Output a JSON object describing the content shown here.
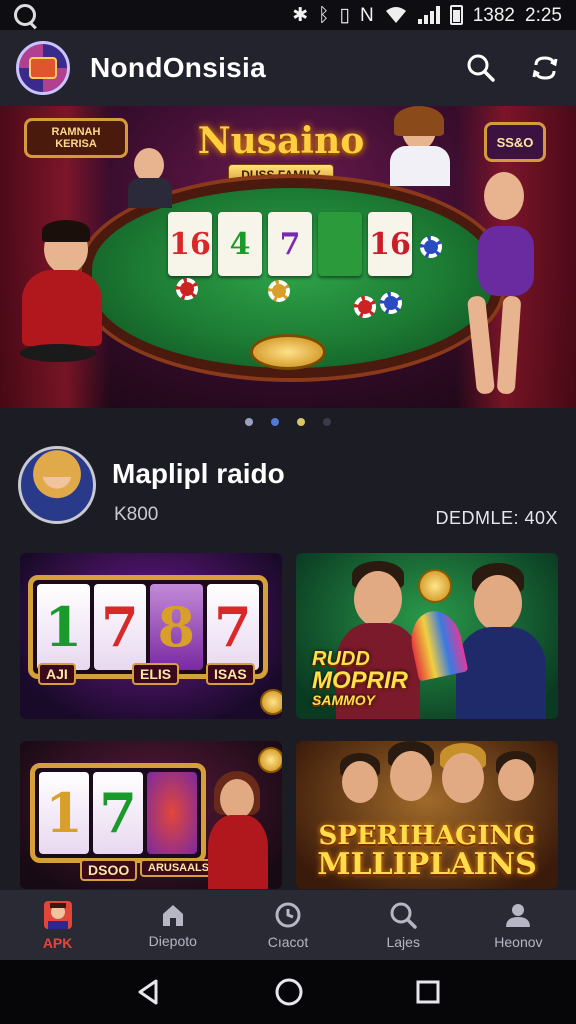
{
  "status_bar": {
    "battery_text": "1382",
    "time": "2:25"
  },
  "app_bar": {
    "title": "NondOnsisia",
    "icons": [
      "search-icon",
      "sync-icon"
    ]
  },
  "hero_banner": {
    "title": "Nusaino",
    "subtitle": "DUSS FAMILY",
    "left_sign": [
      "RAMNAH",
      "KERISA"
    ],
    "right_sign": "SS&O",
    "cards": [
      "16",
      "4",
      "7",
      "",
      "16"
    ],
    "card_colors": [
      "#d8282a",
      "#1a9a2a",
      "#7a2ab0",
      "#1a8a3a",
      "#c81e2a"
    ],
    "carousel": {
      "count": 4,
      "active_index": 1
    }
  },
  "profile": {
    "name": "Mаplipl raido",
    "subtitle": "K800",
    "right_text": "DEDMLE: 40X"
  },
  "games": [
    {
      "id": "slots-purple",
      "reels": [
        "1",
        "7",
        "8",
        "7"
      ],
      "plates": [
        "AJI",
        "ELIS",
        "ISAS"
      ]
    },
    {
      "id": "men-cards",
      "text": [
        "RUDD",
        "MOPRIR",
        "SAMMOY"
      ]
    },
    {
      "id": "slots-girl",
      "reels": [
        "1",
        "7",
        ""
      ],
      "plates": [
        "DSOO",
        "ARUSAALS"
      ]
    },
    {
      "id": "group-men",
      "text": [
        "SPERIHAGING",
        "MLLIPLAINS"
      ]
    }
  ],
  "bottom_nav": {
    "items": [
      {
        "label": "APK",
        "icon": "avatar-icon",
        "active": true
      },
      {
        "label": "Diepoto",
        "icon": "home-icon",
        "active": false
      },
      {
        "label": "Cıacot",
        "icon": "clock-icon",
        "active": false
      },
      {
        "label": "Lajes",
        "icon": "search-icon",
        "active": false
      },
      {
        "label": "Heonov",
        "icon": "person-icon",
        "active": false
      }
    ],
    "active_color": "#e2463a"
  },
  "system_nav": {
    "icons": [
      "back-icon",
      "home-circle-icon",
      "recents-icon"
    ]
  }
}
